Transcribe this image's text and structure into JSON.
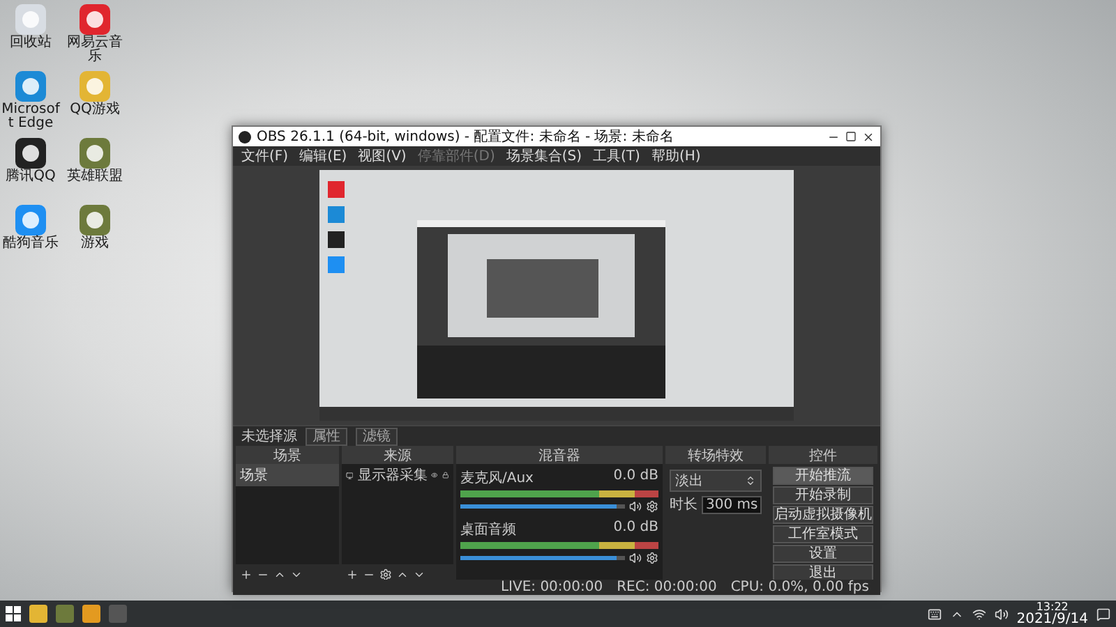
{
  "desktop_icons": [
    {
      "label": "回收站",
      "kind": "bin"
    },
    {
      "label": "网易云音乐",
      "kind": "music"
    },
    {
      "label": "Microsoft Edge",
      "kind": "edge"
    },
    {
      "label": "QQ游戏",
      "kind": "game"
    },
    {
      "label": "腾讯QQ",
      "kind": "qq"
    },
    {
      "label": "英雄联盟",
      "kind": "shield"
    },
    {
      "label": "酷狗音乐",
      "kind": "kugou"
    },
    {
      "label": "游戏",
      "kind": "shield"
    }
  ],
  "window": {
    "title": "OBS 26.1.1 (64-bit, windows) - 配置文件: 未命名 - 场景: 未命名",
    "menu": [
      {
        "label": "文件(F)",
        "disabled": false
      },
      {
        "label": "编辑(E)",
        "disabled": false
      },
      {
        "label": "视图(V)",
        "disabled": false
      },
      {
        "label": "停靠部件(D)",
        "disabled": true
      },
      {
        "label": "场景集合(S)",
        "disabled": false
      },
      {
        "label": "工具(T)",
        "disabled": false
      },
      {
        "label": "帮助(H)",
        "disabled": false
      }
    ],
    "source_toolbar": {
      "label": "未选择源",
      "buttons": [
        "属性",
        "滤镜"
      ]
    },
    "scenes": {
      "title": "场景",
      "items": [
        {
          "label": "场景",
          "selected": true
        }
      ]
    },
    "sources": {
      "title": "来源",
      "items": [
        {
          "label": "显示器采集"
        }
      ]
    },
    "mixer": {
      "title": "混音器",
      "channels": [
        {
          "name": "麦克风/Aux",
          "reading": "0.0 dB",
          "level": 0.95
        },
        {
          "name": "桌面音频",
          "reading": "0.0 dB",
          "level": 0.95
        }
      ]
    },
    "transitions": {
      "title": "转场特效",
      "transition": "淡出",
      "duration_label": "时长",
      "duration": "300 ms"
    },
    "controls": {
      "title": "控件",
      "buttons": [
        {
          "label": "开始推流",
          "selected": true
        },
        {
          "label": "开始录制",
          "selected": false
        },
        {
          "label": "启动虚拟摄像机",
          "selected": false
        },
        {
          "label": "工作室模式",
          "selected": false
        },
        {
          "label": "设置",
          "selected": false
        },
        {
          "label": "退出",
          "selected": false
        }
      ]
    },
    "status": {
      "live": "LIVE: 00:00:00",
      "rec": "REC: 00:00:00",
      "cpu": "CPU: 0.0%, 0.00 fps"
    }
  },
  "taskbar": {
    "time": "13:22",
    "date": "2021/9/14"
  }
}
